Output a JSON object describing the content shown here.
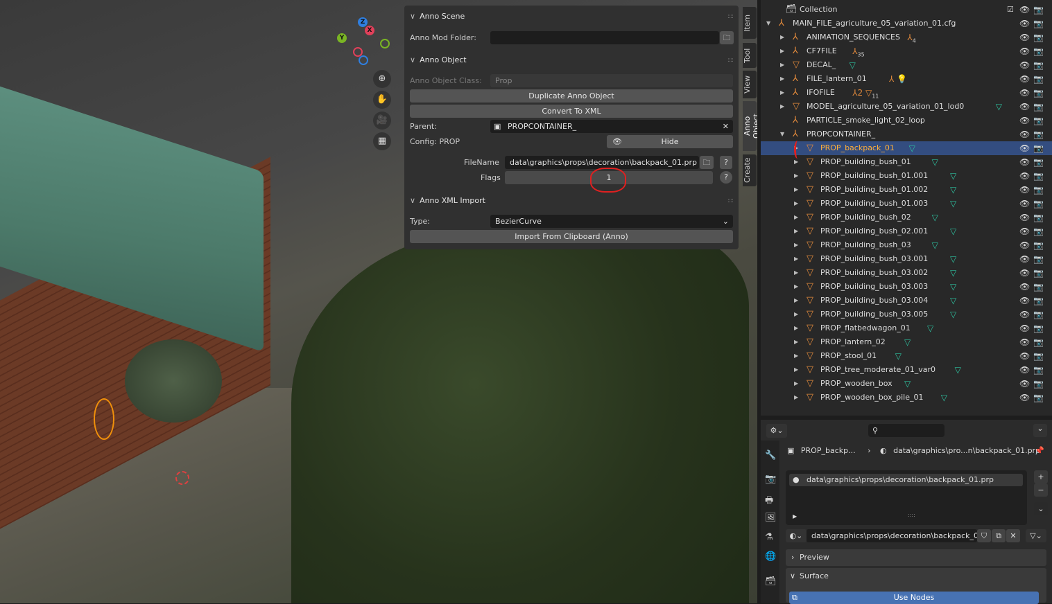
{
  "viewport": {
    "gizmo": {
      "z": "Z",
      "y": "Y",
      "x": "X"
    },
    "nav_icons": [
      "zoom-icon",
      "hand-icon",
      "camera-icon",
      "grid-icon"
    ]
  },
  "npanel": {
    "anno_scene": {
      "title": "Anno Scene",
      "mod_folder_label": "Anno Mod Folder:",
      "mod_folder_value": ""
    },
    "anno_object": {
      "title": "Anno Object",
      "class_label": "Anno Object Class:",
      "class_value": "Prop",
      "duplicate_label": "Duplicate Anno Object",
      "convert_label": "Convert To XML",
      "parent_label": "Parent:",
      "parent_value": "PROPCONTAINER_",
      "config_label": "Config: PROP",
      "hide_label": "Hide",
      "filename_label": "FileName",
      "filename_value": "data\\graphics\\props\\decoration\\backpack_01.prp",
      "flags_label": "Flags",
      "flags_value": "1"
    },
    "anno_xml_import": {
      "title": "Anno XML Import",
      "type_label": "Type:",
      "type_value": "BezierCurve",
      "import_label": "Import From Clipboard (Anno)"
    }
  },
  "tabs": [
    "Item",
    "Tool",
    "View",
    "Anno Object",
    "Create"
  ],
  "active_tab": "Anno Object",
  "outliner": {
    "rows": [
      {
        "name": "Collection",
        "level": 0,
        "icon": "collection",
        "expand": ""
      },
      {
        "name": "MAIN_FILE_agriculture_05_variation_01.cfg",
        "level": 0,
        "icon": "empty",
        "expand": "open"
      },
      {
        "name": "ANIMATION_SEQUENCES",
        "level": 1,
        "icon": "empty",
        "expand": "closed",
        "extra": "⅄",
        "extra_count": "4"
      },
      {
        "name": "CF7FILE",
        "level": 1,
        "icon": "empty",
        "expand": "closed",
        "extra": "⅄",
        "extra_count": "35"
      },
      {
        "name": "DECAL_",
        "level": 1,
        "icon": "mesh",
        "expand": "closed",
        "mesh": true
      },
      {
        "name": "FILE_lantern_01",
        "level": 1,
        "icon": "empty",
        "expand": "closed",
        "extra": "⅄ 💡",
        "extra_count": ""
      },
      {
        "name": "IFOFILE",
        "level": 1,
        "icon": "empty",
        "expand": "closed",
        "extra": "⅄2 ▽",
        "extra_count": "11"
      },
      {
        "name": "MODEL_agriculture_05_variation_01_lod0",
        "level": 1,
        "icon": "mesh",
        "expand": "closed",
        "mesh": true
      },
      {
        "name": "PARTICLE_smoke_light_02_loop",
        "level": 1,
        "icon": "empty",
        "expand": ""
      },
      {
        "name": "PROPCONTAINER_",
        "level": 1,
        "icon": "empty",
        "expand": "open"
      },
      {
        "name": "PROP_backpack_01",
        "level": 2,
        "icon": "mesh",
        "expand": "closed",
        "mesh": true,
        "selected": true
      },
      {
        "name": "PROP_building_bush_01",
        "level": 2,
        "icon": "mesh",
        "expand": "closed",
        "mesh": true
      },
      {
        "name": "PROP_building_bush_01.001",
        "level": 2,
        "icon": "mesh",
        "expand": "closed",
        "mesh": true
      },
      {
        "name": "PROP_building_bush_01.002",
        "level": 2,
        "icon": "mesh",
        "expand": "closed",
        "mesh": true
      },
      {
        "name": "PROP_building_bush_01.003",
        "level": 2,
        "icon": "mesh",
        "expand": "closed",
        "mesh": true
      },
      {
        "name": "PROP_building_bush_02",
        "level": 2,
        "icon": "mesh",
        "expand": "closed",
        "mesh": true
      },
      {
        "name": "PROP_building_bush_02.001",
        "level": 2,
        "icon": "mesh",
        "expand": "closed",
        "mesh": true
      },
      {
        "name": "PROP_building_bush_03",
        "level": 2,
        "icon": "mesh",
        "expand": "closed",
        "mesh": true
      },
      {
        "name": "PROP_building_bush_03.001",
        "level": 2,
        "icon": "mesh",
        "expand": "closed",
        "mesh": true
      },
      {
        "name": "PROP_building_bush_03.002",
        "level": 2,
        "icon": "mesh",
        "expand": "closed",
        "mesh": true
      },
      {
        "name": "PROP_building_bush_03.003",
        "level": 2,
        "icon": "mesh",
        "expand": "closed",
        "mesh": true
      },
      {
        "name": "PROP_building_bush_03.004",
        "level": 2,
        "icon": "mesh",
        "expand": "closed",
        "mesh": true
      },
      {
        "name": "PROP_building_bush_03.005",
        "level": 2,
        "icon": "mesh",
        "expand": "closed",
        "mesh": true
      },
      {
        "name": "PROP_flatbedwagon_01",
        "level": 2,
        "icon": "mesh",
        "expand": "closed",
        "mesh": true
      },
      {
        "name": "PROP_lantern_02",
        "level": 2,
        "icon": "mesh",
        "expand": "closed",
        "mesh": true
      },
      {
        "name": "PROP_stool_01",
        "level": 2,
        "icon": "mesh",
        "expand": "closed",
        "mesh": true
      },
      {
        "name": "PROP_tree_moderate_01_var0",
        "level": 2,
        "icon": "mesh",
        "expand": "closed",
        "mesh": true
      },
      {
        "name": "PROP_wooden_box",
        "level": 2,
        "icon": "mesh",
        "expand": "closed",
        "mesh": true
      },
      {
        "name": "PROP_wooden_box_pile_01",
        "level": 2,
        "icon": "mesh",
        "expand": "closed",
        "mesh": true
      }
    ]
  },
  "properties": {
    "breadcrumb_object": "PROP_backp...",
    "breadcrumb_material": "data\\graphics\\pro...n\\backpack_01.prp",
    "slot_item": "data\\graphics\\props\\decoration\\backpack_01.prp",
    "material_field": "data\\graphics\\props\\decoration\\backpack_0...",
    "preview_label": "Preview",
    "surface_label": "Surface",
    "use_nodes_label": "Use Nodes"
  },
  "colors": {
    "selection": "#334d80",
    "accent_orange": "#e28a3c",
    "mesh_green": "#2ec2a0",
    "use_nodes_blue": "#4772b3",
    "annotation_red": "#e02020"
  }
}
